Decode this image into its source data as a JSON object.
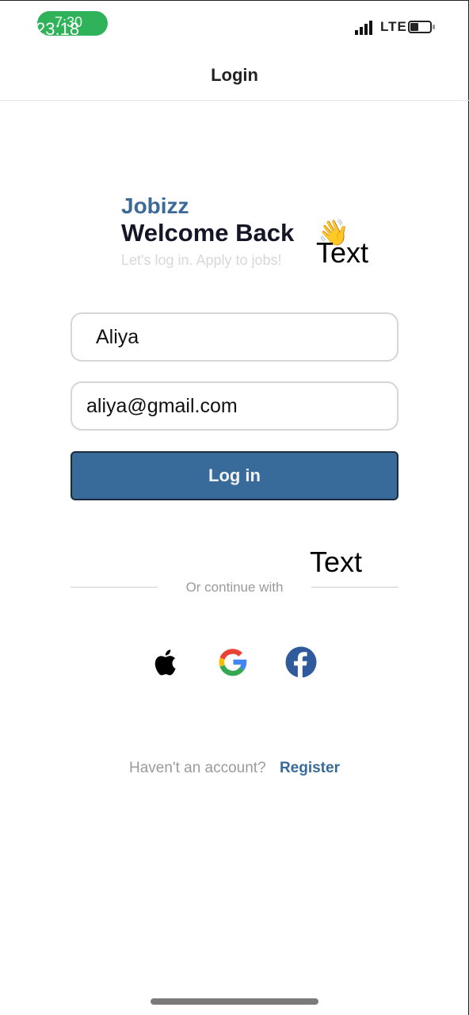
{
  "status_bar": {
    "time_top": "7:30",
    "time_bottom": "23:18",
    "network": "LTE",
    "pill_color": "#2fb25a"
  },
  "nav": {
    "title": "Login"
  },
  "hero": {
    "brand": "Jobizz",
    "welcome": "Welcome Back",
    "wave_emoji": "👋",
    "subtitle": "Let's log in. Apply to jobs!"
  },
  "annotations": {
    "label_1": "Text",
    "label_2": "Text"
  },
  "form": {
    "name_value": "Aliya",
    "email_value": "aliya@gmail.com",
    "login_label": "Log in"
  },
  "social": {
    "divider_text": "Or continue with",
    "icons": [
      "apple-icon",
      "google-icon",
      "facebook-icon"
    ]
  },
  "footer": {
    "question": "Haven't an account?",
    "register_label": "Register"
  },
  "colors": {
    "accent": "#386a9a",
    "brand_text": "#3c6a98",
    "heading": "#151528",
    "muted": "#9a9a9a"
  }
}
